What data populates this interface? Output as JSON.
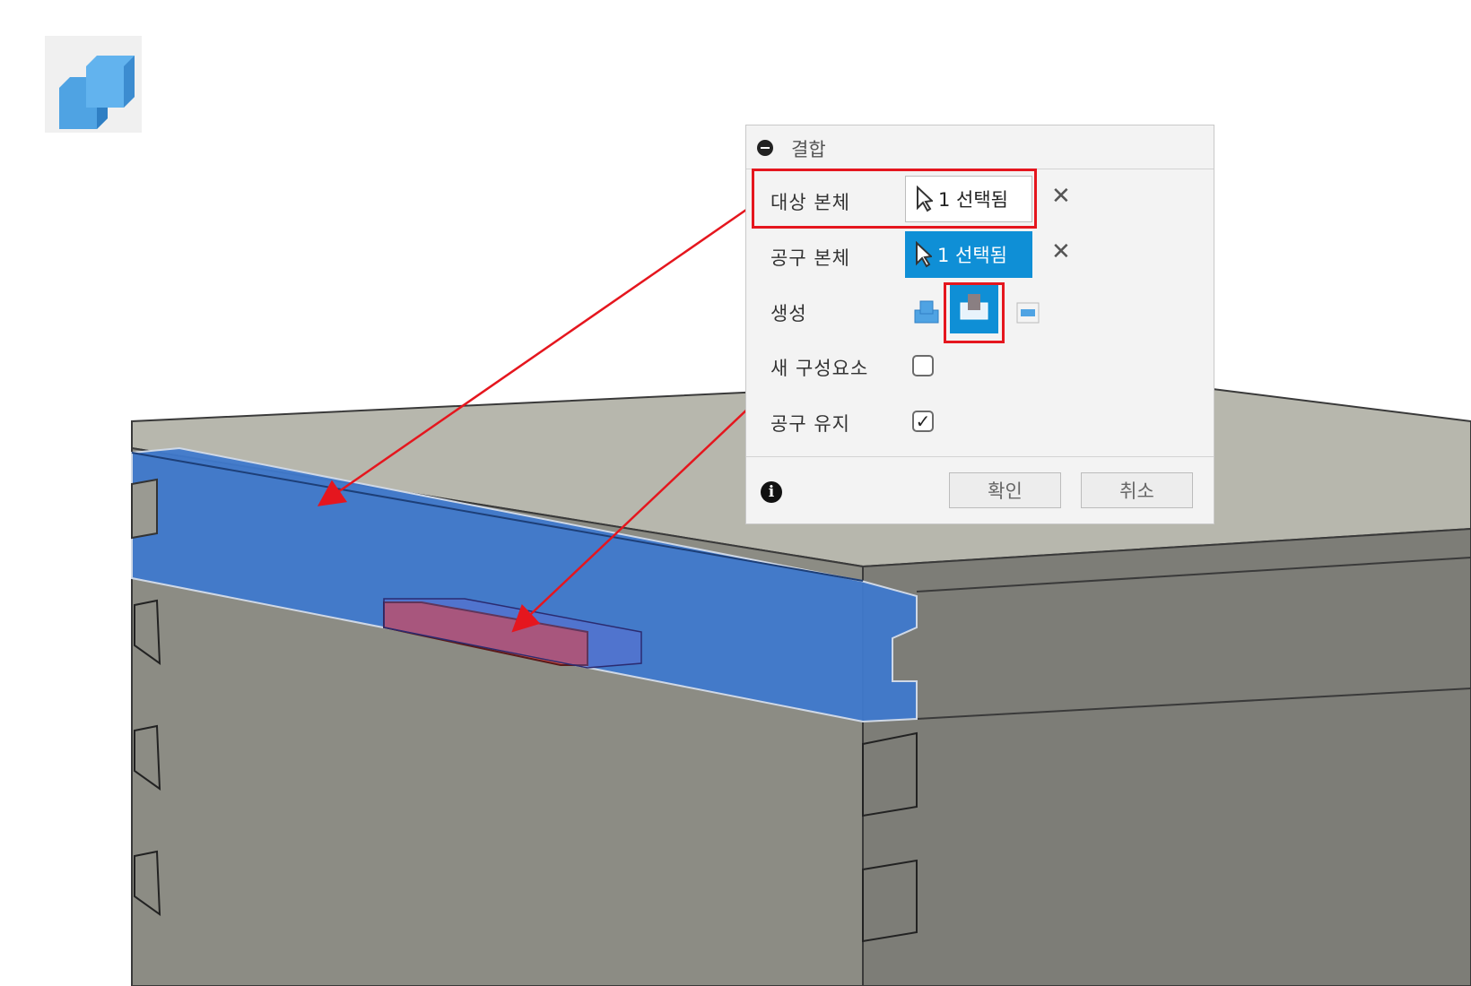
{
  "tool_icon": {
    "name": "combine-icon",
    "accent": "#5aa9e6"
  },
  "panel": {
    "title": "결합",
    "target_label": "대상 본체",
    "target_value": "1 선택됨",
    "tool_label": "공구 본체",
    "tool_value": "1 선택됨",
    "operation_label": "생성",
    "operations": [
      {
        "name": "join-icon",
        "selected": false
      },
      {
        "name": "cut-icon",
        "selected": true
      },
      {
        "name": "intersect-icon",
        "selected": false
      }
    ],
    "new_component_label": "새 구성요소",
    "new_component_checked": false,
    "keep_tools_label": "공구 유지",
    "keep_tools_checked": true,
    "check_mark": "✓",
    "ok_label": "확인",
    "cancel_label": "취소",
    "clear_glyph": "✕",
    "info_glyph": "i"
  },
  "colors": {
    "accent": "#0f8fd6",
    "highlight": "#e5161e",
    "target_body": "#3f79cc",
    "tool_body": "#d9473f",
    "box_top": "#b7b7ad",
    "box_front": "#8c8c84",
    "box_side": "#7d7d77"
  }
}
